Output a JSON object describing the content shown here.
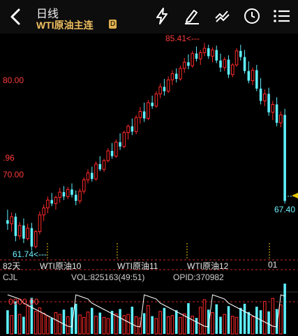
{
  "header": {
    "back_icon": "back-chevron-icon",
    "title": "日线",
    "subtitle": "WTI原油主连",
    "badge": "D",
    "tools": [
      "lightning-icon",
      "draw-pen-icon",
      "indicator-lines-icon",
      "clock-icon",
      "menu-list-icon"
    ]
  },
  "price_labels": {
    "high": "85.41<---",
    "low": "61.74<---",
    "last": "67.40",
    "axis_80": "80.00",
    "axis_70": "70.00",
    "axis_96": ".96"
  },
  "x_axis": {
    "left_days": "82天",
    "contracts": [
      "WTI原油10",
      "WTI原油11",
      "WTI原油12",
      "01"
    ]
  },
  "volume_bar": {
    "name": "CJL",
    "vol": "VOL:825163(49:51)",
    "opid": "OPID:370982",
    "axis_label": "0000.00"
  },
  "colors": {
    "up": "#ff2a2a",
    "down": "#5ff0ff",
    "dashed_line": "#c62828",
    "marker": "#e6c200"
  },
  "chart_data": {
    "type": "candlestick",
    "instrument": "WTI原油主连",
    "period": "日线",
    "high": 85.41,
    "low": 61.74,
    "last": 67.4,
    "y_ticks": [
      80.0,
      70.0
    ],
    "x_ticks": [
      "WTI原油10",
      "WTI原油11",
      "WTI原油12",
      "01"
    ],
    "ohlc": [
      [
        65.2,
        66.4,
        64.1,
        64.8
      ],
      [
        64.8,
        66.1,
        63.9,
        65.6
      ],
      [
        65.6,
        66.0,
        62.8,
        63.4
      ],
      [
        63.4,
        65.0,
        63.0,
        64.6
      ],
      [
        64.6,
        65.4,
        62.6,
        63.1
      ],
      [
        63.1,
        64.8,
        62.9,
        64.3
      ],
      [
        64.3,
        64.9,
        61.74,
        62.2
      ],
      [
        62.2,
        64.1,
        62.0,
        63.9
      ],
      [
        63.9,
        66.2,
        63.6,
        65.8
      ],
      [
        65.8,
        67.0,
        65.1,
        66.6
      ],
      [
        66.6,
        67.9,
        66.0,
        67.5
      ],
      [
        67.5,
        68.3,
        66.8,
        67.1
      ],
      [
        67.1,
        68.0,
        66.4,
        67.8
      ],
      [
        67.8,
        68.9,
        67.2,
        68.4
      ],
      [
        68.4,
        69.1,
        67.5,
        67.9
      ],
      [
        67.9,
        69.0,
        67.6,
        68.7
      ],
      [
        68.7,
        69.4,
        67.8,
        68.1
      ],
      [
        68.1,
        68.6,
        66.9,
        67.4
      ],
      [
        67.4,
        68.8,
        67.1,
        68.5
      ],
      [
        68.5,
        70.1,
        68.2,
        69.8
      ],
      [
        69.8,
        71.0,
        69.4,
        70.6
      ],
      [
        70.6,
        71.3,
        69.6,
        69.9
      ],
      [
        69.9,
        71.9,
        69.7,
        71.6
      ],
      [
        71.6,
        72.5,
        70.8,
        71.0
      ],
      [
        71.0,
        72.2,
        70.7,
        72.0
      ],
      [
        72.0,
        73.4,
        71.8,
        73.1
      ],
      [
        73.1,
        74.0,
        72.2,
        72.5
      ],
      [
        72.5,
        74.4,
        72.3,
        74.1
      ],
      [
        74.1,
        75.1,
        73.2,
        73.6
      ],
      [
        73.6,
        75.4,
        73.4,
        75.2
      ],
      [
        75.2,
        76.1,
        74.4,
        75.9
      ],
      [
        75.9,
        76.8,
        74.9,
        75.3
      ],
      [
        75.3,
        77.2,
        75.0,
        76.9
      ],
      [
        76.9,
        78.1,
        76.2,
        77.6
      ],
      [
        77.6,
        78.6,
        76.4,
        76.8
      ],
      [
        76.8,
        78.9,
        76.6,
        78.6
      ],
      [
        78.6,
        79.4,
        77.9,
        78.2
      ],
      [
        78.2,
        79.9,
        78.0,
        79.6
      ],
      [
        79.6,
        80.8,
        79.1,
        80.4
      ],
      [
        80.4,
        81.3,
        79.4,
        79.9
      ],
      [
        79.9,
        81.6,
        79.7,
        81.2
      ],
      [
        81.2,
        82.3,
        80.6,
        81.9
      ],
      [
        81.9,
        82.5,
        80.9,
        81.3
      ],
      [
        81.3,
        82.8,
        81.1,
        82.5
      ],
      [
        82.5,
        83.7,
        82.0,
        83.2
      ],
      [
        83.2,
        84.1,
        82.4,
        82.8
      ],
      [
        82.8,
        84.5,
        82.6,
        84.2
      ],
      [
        84.2,
        85.0,
        83.3,
        83.6
      ],
      [
        83.6,
        84.6,
        82.9,
        84.3
      ],
      [
        84.3,
        85.41,
        83.9,
        84.8
      ],
      [
        84.8,
        85.2,
        83.6,
        83.9
      ],
      [
        83.9,
        84.9,
        83.2,
        84.6
      ],
      [
        84.6,
        85.1,
        83.1,
        83.4
      ],
      [
        83.4,
        84.2,
        82.1,
        82.6
      ],
      [
        82.6,
        83.8,
        82.2,
        83.5
      ],
      [
        83.5,
        84.0,
        81.4,
        81.8
      ],
      [
        81.8,
        83.1,
        81.5,
        82.9
      ],
      [
        82.9,
        84.8,
        82.7,
        84.5
      ],
      [
        84.5,
        85.2,
        83.4,
        83.8
      ],
      [
        83.8,
        84.6,
        81.9,
        82.2
      ],
      [
        82.2,
        83.3,
        80.8,
        81.1
      ],
      [
        81.1,
        82.6,
        80.6,
        82.3
      ],
      [
        82.3,
        82.9,
        79.9,
        80.2
      ],
      [
        80.2,
        81.4,
        78.4,
        78.8
      ],
      [
        78.8,
        80.1,
        78.2,
        79.6
      ],
      [
        79.6,
        80.3,
        77.1,
        77.5
      ],
      [
        77.5,
        78.8,
        76.6,
        78.4
      ],
      [
        78.4,
        79.2,
        75.9,
        76.3
      ],
      [
        76.3,
        77.6,
        75.8,
        77.2
      ],
      [
        77.2,
        77.9,
        67.1,
        67.4
      ]
    ],
    "volume": [
      40,
      31,
      55,
      33,
      29,
      47,
      61,
      38,
      44,
      35,
      30,
      27,
      36,
      33,
      41,
      29,
      45,
      51,
      32,
      28,
      37,
      44,
      30,
      36,
      28,
      26,
      39,
      34,
      42,
      31,
      33,
      46,
      29,
      27,
      35,
      48,
      30,
      26,
      38,
      44,
      29,
      31,
      40,
      28,
      34,
      52,
      30,
      27,
      45,
      58,
      41,
      36,
      50,
      29,
      33,
      47,
      30,
      28,
      44,
      51,
      37,
      29,
      46,
      40,
      55,
      38,
      60,
      42,
      49,
      85
    ]
  }
}
